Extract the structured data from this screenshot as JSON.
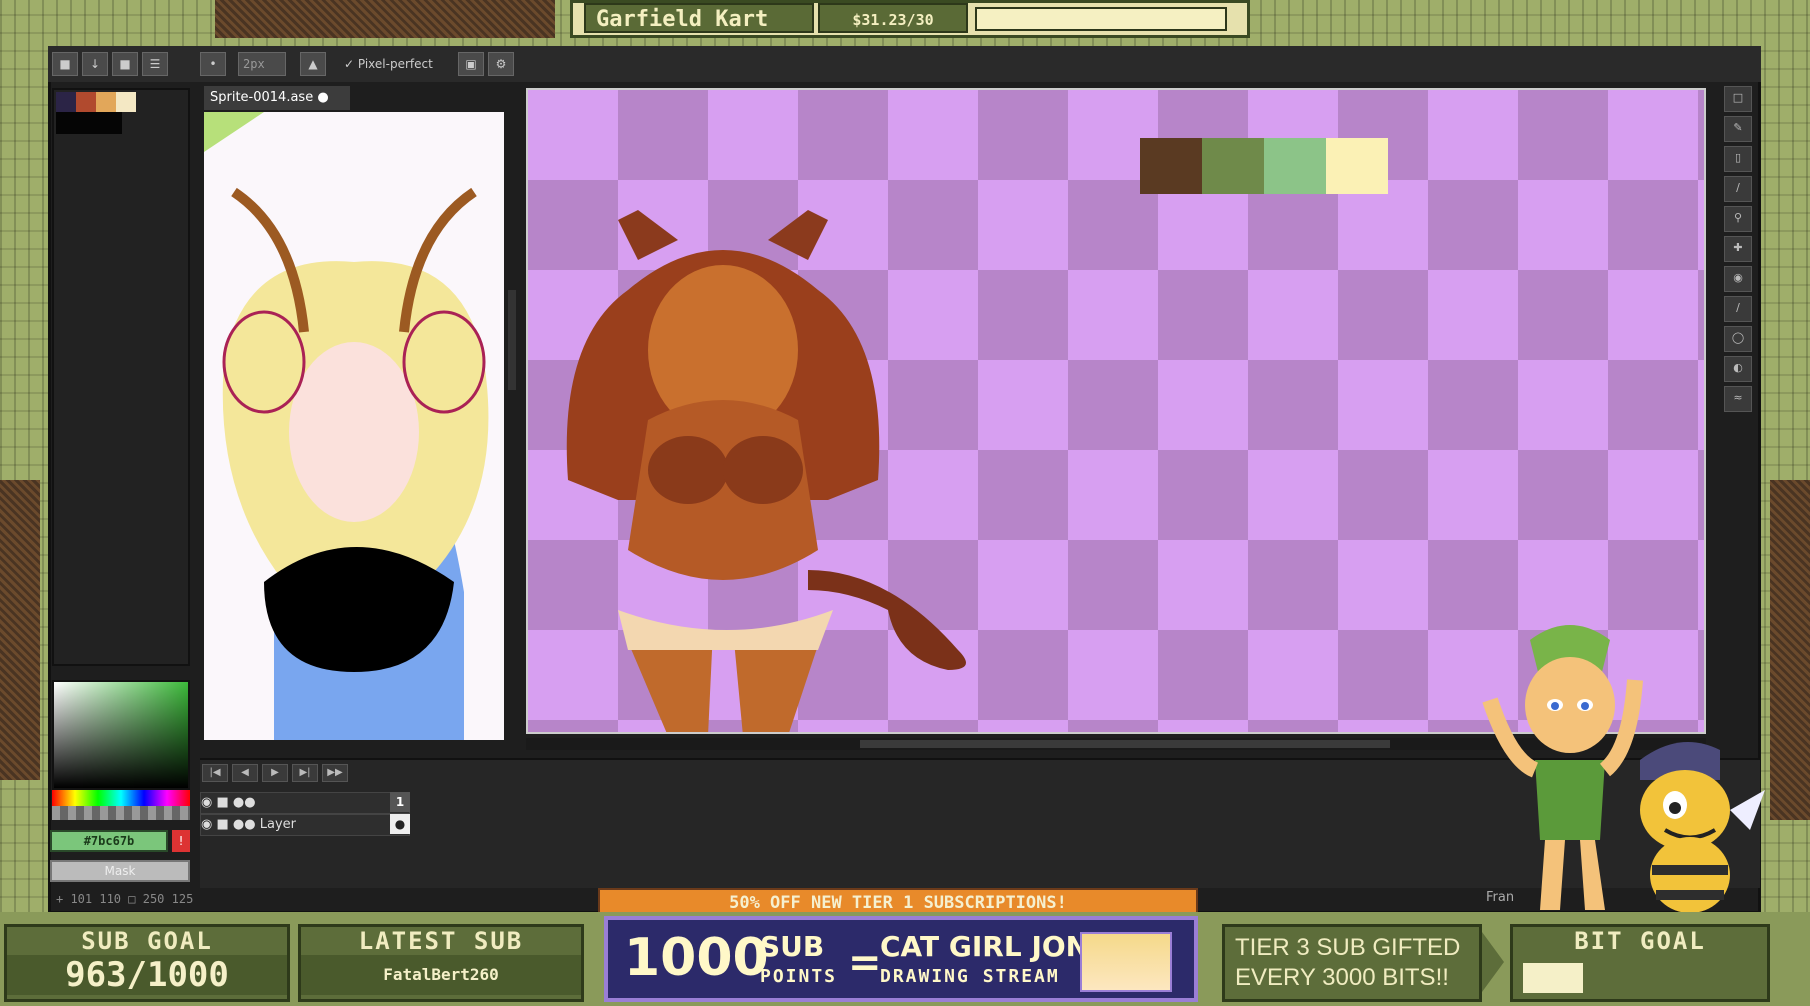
{
  "overlay": {
    "game_title": "Garfield Kart",
    "donation_amount": "$31.23/30",
    "promo_banner": "50% OFF NEW TIER 1 SUBSCRIPTIONS!",
    "sub_goal_label": "SUB GOAL",
    "sub_goal_value": "963/1000",
    "latest_sub_label": "LATEST SUB",
    "latest_sub_name": "FatalBert260",
    "points_number": "1000",
    "points_sub": "SUB",
    "points_word": "POINTS",
    "equals": "=",
    "reward_line1": "CAT GIRL JON",
    "reward_line2": "DRAWING STREAM",
    "tier3_line1": "TIER 3 SUB GIFTED",
    "tier3_line2": "EVERY 3000 BITS!!",
    "bit_goal_label": "BIT GOAL"
  },
  "editor": {
    "brush_size": "2px",
    "pixel_perfect_label": "Pixel-perfect",
    "file_tab": "Sprite-0014.ase",
    "hex_color": "#7bc67b",
    "mask_label": "Mask",
    "status_coords": "101 110",
    "status_size": "250 125",
    "layer_name": "Layer",
    "frame_number": "1",
    "frame_label": "Fran",
    "palette": [
      "#2b2446",
      "#b14a2e",
      "#e2a75a",
      "#f4e8c4"
    ],
    "canvas_palette": [
      "#5a3a22",
      "#6f8a4a",
      "#8cc488",
      "#fbf1b5"
    ]
  }
}
